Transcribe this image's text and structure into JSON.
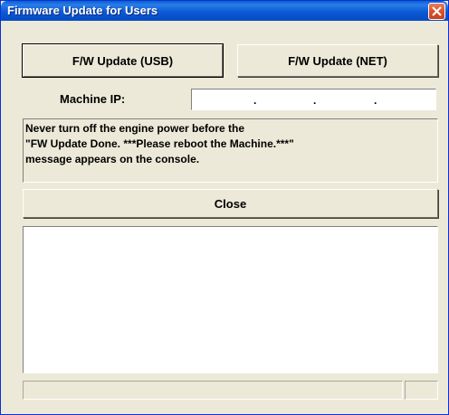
{
  "window": {
    "title": "Firmware Update for Users"
  },
  "buttons": {
    "usb_label": "F/W Update (USB)",
    "net_label": "F/W Update (NET)",
    "close_label": "Close"
  },
  "machine_ip": {
    "label": "Machine IP:",
    "separator": ".",
    "value": ""
  },
  "message": {
    "lines": [
      "Never turn off the engine power before the",
      "\"FW Update Done. ***Please reboot the Machine.***\"",
      "message appears on the console."
    ]
  },
  "icons": {
    "close": "close-icon"
  },
  "colors": {
    "titlebar": "#0b59d6",
    "dialog_bg": "#ece9d8",
    "close_button": "#d9542b"
  }
}
